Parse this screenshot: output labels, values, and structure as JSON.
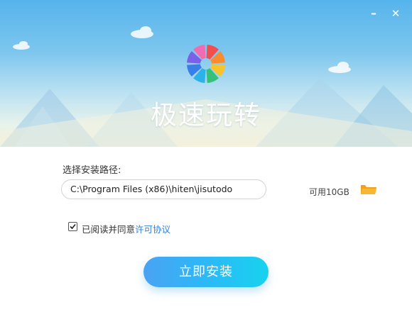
{
  "window": {
    "minimize_glyph": "–",
    "close_glyph": "✕"
  },
  "banner": {
    "app_name": "极速玩转",
    "logo_colors": [
      "#f44d4d",
      "#fb8c2e",
      "#f9c42a",
      "#37c07a",
      "#2bb3e8",
      "#3a7ee8",
      "#7b61e8",
      "#f06bb0"
    ]
  },
  "install": {
    "path_label": "选择安装路径:",
    "path_value": "C:\\Program Files (x86)\\hiten\\jisutodo",
    "available_space": "可用10GB",
    "folder_icon": "folder-icon",
    "agree_checked": true,
    "agree_text": "已阅读并同意",
    "agree_link": "许可协议",
    "install_button": "立即安装"
  },
  "colors": {
    "accent": "#2fb6f7",
    "link": "#2f80d4",
    "folder": "#f5a623"
  }
}
